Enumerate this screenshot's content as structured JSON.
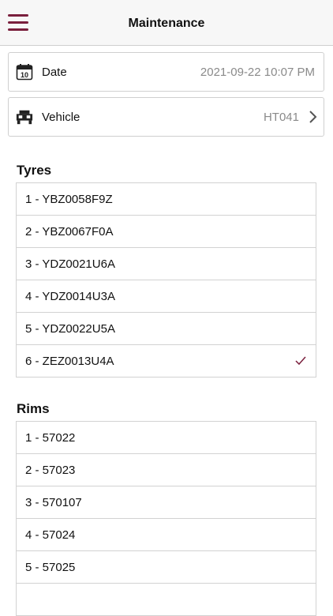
{
  "colors": {
    "accent": "#7a1f3d",
    "chevron": "#555555",
    "muted": "#8a8a8a"
  },
  "header": {
    "title": "Maintenance",
    "menu_icon": "hamburger-menu-icon"
  },
  "fields": {
    "date": {
      "label": "Date",
      "value": "2021-09-22 10:07 PM",
      "icon": "calendar-icon",
      "calendar_day": "10"
    },
    "vehicle": {
      "label": "Vehicle",
      "value": "HT041",
      "icon": "truck-icon"
    }
  },
  "tyres": {
    "title": "Tyres",
    "items": [
      {
        "label": "1 - YBZ0058F9Z",
        "selected": false
      },
      {
        "label": "2 - YBZ0067F0A",
        "selected": false
      },
      {
        "label": "3 - YDZ0021U6A",
        "selected": false
      },
      {
        "label": "4 - YDZ0014U3A",
        "selected": false
      },
      {
        "label": "5 - YDZ0022U5A",
        "selected": false
      },
      {
        "label": "6 - ZEZ0013U4A",
        "selected": true
      }
    ]
  },
  "rims": {
    "title": "Rims",
    "items": [
      {
        "label": "1 - 57022"
      },
      {
        "label": "2 - 57023"
      },
      {
        "label": "3 - 570107"
      },
      {
        "label": "4 - 57024"
      },
      {
        "label": "5 - 57025"
      },
      {
        "label": ""
      }
    ]
  }
}
